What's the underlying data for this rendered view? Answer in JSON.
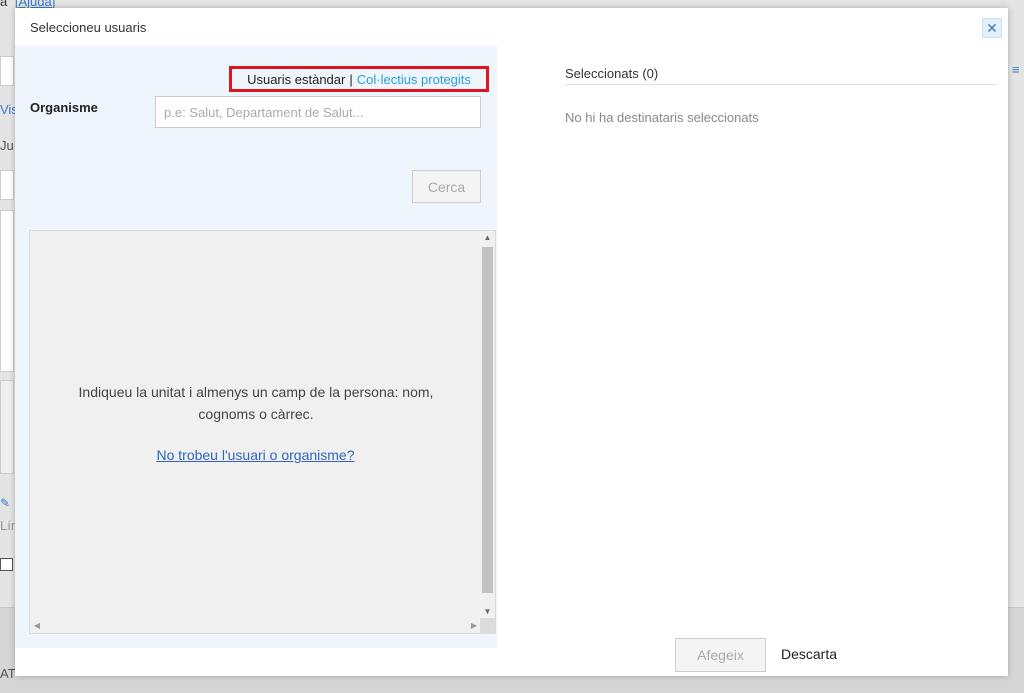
{
  "background": {
    "top_text": "a",
    "help_link": "[Ajuda]",
    "fragments": [
      "Vis",
      "Ju",
      "Lín",
      "AT"
    ]
  },
  "modal": {
    "title": "Seleccioneu usuaris",
    "close_icon": "close-icon",
    "user_type": {
      "standard": "Usuaris estàndar",
      "separator": "|",
      "protected": "Col·lectius protegits"
    },
    "organism": {
      "label": "Organisme",
      "placeholder": "p.e: Salut, Departament de Salut...",
      "value": ""
    },
    "search_button": "Cerca",
    "results": {
      "message": "Indiqueu la unitat i almenys un camp de la persona: nom, cognoms o càrrec.",
      "link": "No trobeu l'usuari o organisme?"
    },
    "selected": {
      "title": "Seleccionats (0)",
      "empty_message": "No hi ha destinataris seleccionats"
    },
    "add_button": "Afegeix",
    "discard_link": "Descarta"
  },
  "colors": {
    "accent_link": "#2a9fd8",
    "highlight_border": "#e0141e",
    "panel_background": "#eef5fd"
  }
}
